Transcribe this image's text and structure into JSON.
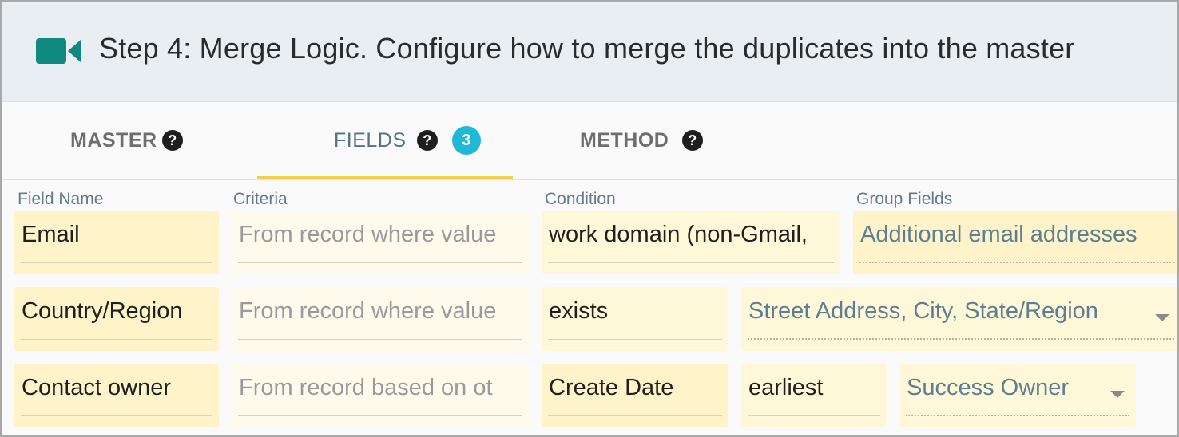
{
  "header": {
    "title": "Step 4: Merge Logic. Configure how to merge the duplicates into the master",
    "icon": "video-camera-icon",
    "icon_color": "#0f8a80"
  },
  "tabs": [
    {
      "label": "MASTER",
      "help": "?"
    },
    {
      "label": "FIELDS",
      "help": "?",
      "badge": "3",
      "active": true
    },
    {
      "label": "METHOD",
      "help": "?"
    }
  ],
  "columns": {
    "field_name": "Field Name",
    "criteria": "Criteria",
    "condition": "Condition",
    "group_fields": "Group Fields"
  },
  "rows": [
    {
      "field": "Email",
      "criteria_placeholder": "From record where value",
      "condition": "work domain (non-Gmail,",
      "group": "Additional email addresses"
    },
    {
      "field": "Country/Region",
      "criteria_placeholder": "From record where value",
      "condition": "exists",
      "group": "Street Address, City, State/Region"
    },
    {
      "field": "Contact owner",
      "criteria_placeholder": "From record based on ot",
      "condition": "Create Date",
      "condition_extra": "earliest",
      "group": "Success Owner"
    }
  ],
  "colors": {
    "accent_underline": "#f3cf4f",
    "badge": "#1fb8d6",
    "cell_bg": "#fff8d8",
    "header_bg": "#e9eef2"
  }
}
